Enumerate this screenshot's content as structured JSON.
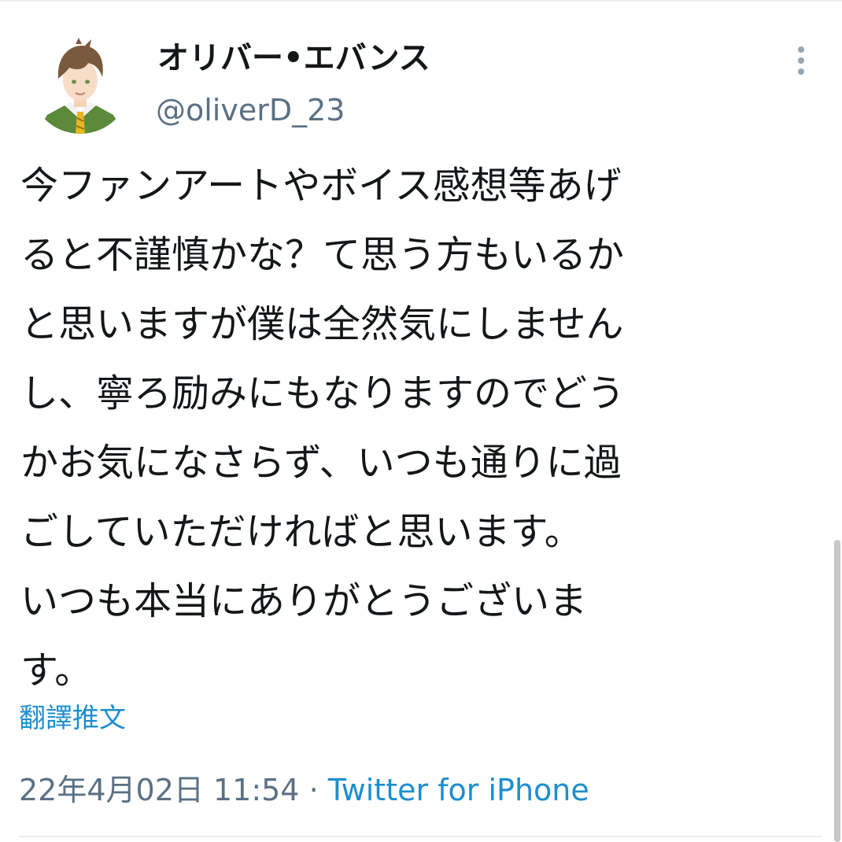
{
  "user": {
    "display_name": "オリバー•エバンス",
    "handle": "@oliverD_23"
  },
  "tweet": {
    "lines": [
      "今ファンアートやボイス感想等あげ",
      "ると不謹慎かな？て思う方もいるか",
      "と思いますが僕は全然気にしません",
      "し、寧ろ励みにもなりますのでどう",
      "かお気になさらず、いつも通りに過",
      "ごしていただければと思います。",
      "いつも本当にありがとうございま",
      "す。"
    ],
    "translate_label": "翻譯推文"
  },
  "meta": {
    "timestamp": "22年4月02日 11:54",
    "separator": " · ",
    "source": "Twitter for iPhone"
  },
  "icons": {
    "more": "vertical-ellipsis-icon"
  },
  "colors": {
    "link": "#1d8ecf",
    "secondary_text": "#5b7083",
    "primary_text": "#14171a"
  }
}
